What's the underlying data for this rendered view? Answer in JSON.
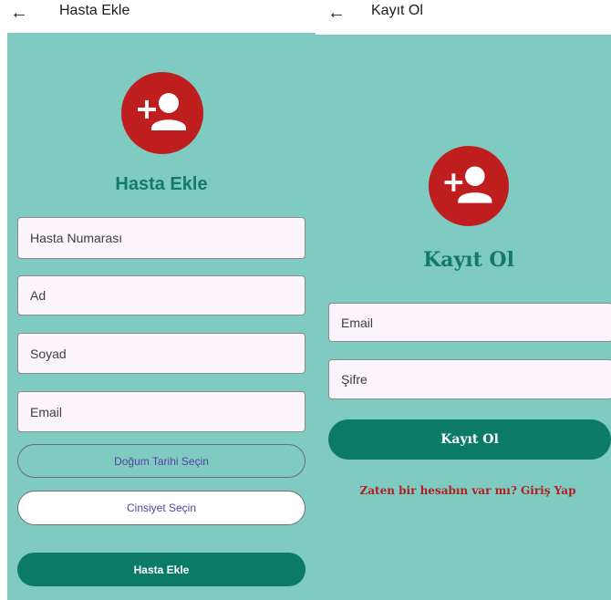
{
  "hasta_ekle": {
    "app_bar_title": "Hasta Ekle",
    "heading": "Hasta Ekle",
    "fields": {
      "hasta_numarasi_placeholder": "Hasta Numarası",
      "ad_placeholder": "Ad",
      "soyad_placeholder": "Soyad",
      "email_placeholder": "Email"
    },
    "dogum_tarihi_button": "Doğum Tarihi Seçin",
    "cinsiyet_button": "Cinsiyet Seçin",
    "submit_button": "Hasta Ekle"
  },
  "kayit_ol": {
    "app_bar_title": "Kayıt Ol",
    "heading": "Kayıt Ol",
    "fields": {
      "email_placeholder": "Email",
      "sifre_placeholder": "Şifre"
    },
    "submit_button": "Kayıt Ol",
    "login_link": "Zaten bir hesabın var mı? Giriş Yap"
  },
  "icons": {
    "back": "arrow-left-icon",
    "avatar": "person-add-icon"
  },
  "colors": {
    "background": "#7fcbc2",
    "avatar_red": "#bf1e1e",
    "heading_teal": "#12796b",
    "button_teal": "#0b7a66",
    "link_red": "#b01f1f",
    "button_text_purple": "#5a3fa0"
  }
}
